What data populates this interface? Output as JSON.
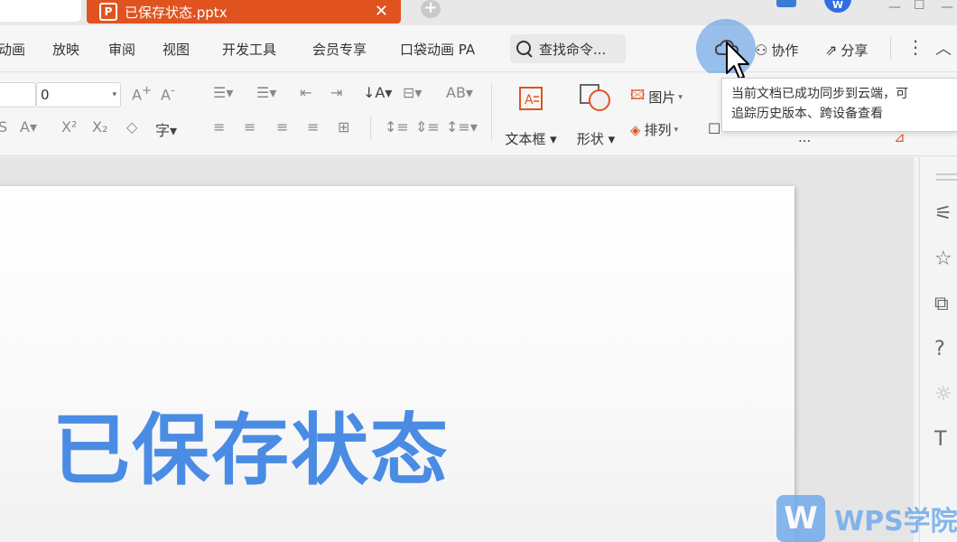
{
  "titlebar": {
    "active_tab_icon": "P",
    "active_tab_title": "已保存状态.pptx",
    "close_glyph": "✕",
    "add_glyph": "+",
    "avatar_initial": "W"
  },
  "menu": {
    "items": [
      "动画",
      "放映",
      "审阅",
      "视图",
      "开发工具",
      "会员专享",
      "口袋动画 PA"
    ],
    "search_placeholder": "查找命令...",
    "collaborate": "协作",
    "share": "分享"
  },
  "toolbar": {
    "font_size_value": "0",
    "insert_textbox": "文本框",
    "insert_shape": "形状",
    "insert_picture": "图片",
    "arrange": "排列"
  },
  "tooltip": {
    "line1": "当前文档已成功同步到云端，可",
    "line2": "追踪历史版本、跨设备查看"
  },
  "slide": {
    "title": "已保存状态"
  },
  "watermark": {
    "logo": "W",
    "text": "WPS学院"
  },
  "colors": {
    "accent_tab": "#e0531f",
    "slide_title": "#4a8ce4",
    "cloud_highlight": "#4a90e2"
  }
}
